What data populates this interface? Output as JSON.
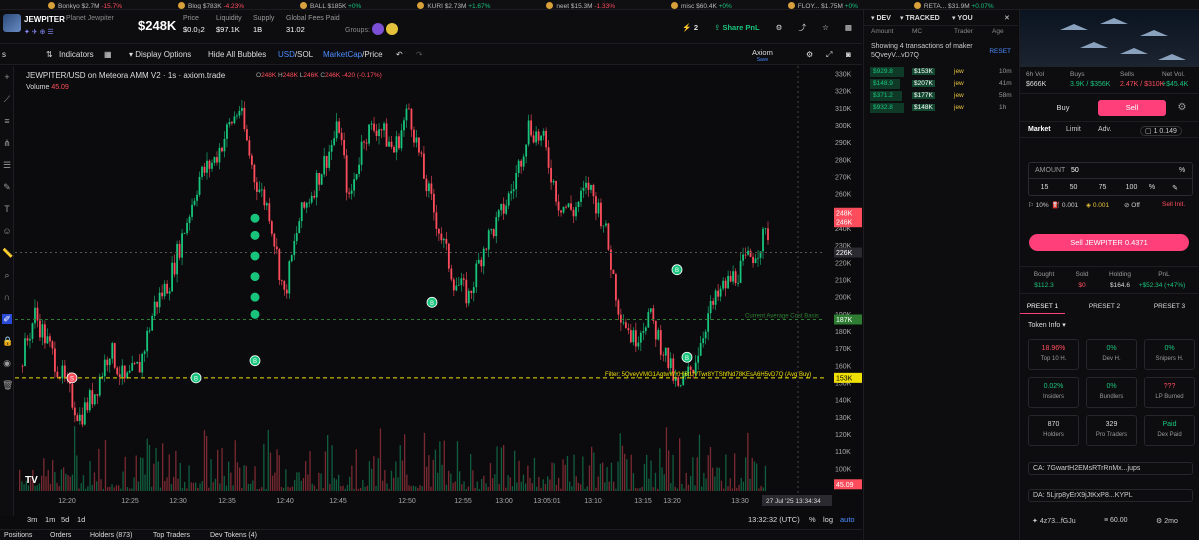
{
  "ticker_strip": [
    {
      "name": "Bonkyo",
      "value": "$2.7M",
      "change": "-15.7%",
      "dir": "dn"
    },
    {
      "name": "Blog",
      "value": "$783K",
      "change": "-4.23%",
      "dir": "dn"
    },
    {
      "name": "BALL",
      "value": "$185K",
      "change": "+0%",
      "dir": "up"
    },
    {
      "name": "KURI",
      "value": "$2.73M",
      "change": "+1.67%",
      "dir": "up"
    },
    {
      "name": "neet",
      "value": "$15.3M",
      "change": "-1.33%",
      "dir": "dn"
    },
    {
      "name": "misc",
      "value": "$60.4K",
      "change": "+0%",
      "dir": "up"
    },
    {
      "name": "FLOY...",
      "value": "$1.75M",
      "change": "+0%",
      "dir": "up"
    },
    {
      "name": "RETA...",
      "value": "$31.9M",
      "change": "+0.07%",
      "dir": "up"
    }
  ],
  "header": {
    "ticker": "JEWPITER",
    "full_name": "Planet Jewpiter",
    "market_cap": "$248K",
    "stats": [
      {
        "label": "Price",
        "value": "$0.0₃2"
      },
      {
        "label": "Liquidity",
        "value": "$97.1K"
      },
      {
        "label": "Supply",
        "value": "1B"
      },
      {
        "label": "Global Fees Paid",
        "value": "31.02"
      }
    ],
    "groups_label": "Groups:",
    "watch_count": "2",
    "share_pnl": "Share PnL"
  },
  "toolbar": {
    "indicators": "Indicators",
    "display_options": "Display Options",
    "hide_bubbles": "Hide All Bubbles",
    "usd": "USD",
    "sol": "SOL",
    "marketcap": "MarketCap",
    "price": "Price",
    "axiom": "Axiom",
    "axiom_sub": "Save"
  },
  "chart_info": {
    "title": "JEWPITER/USD on Meteora AMM V2 · 1s · axiom.trade",
    "ohlc": {
      "o": "248K",
      "h": "248K",
      "l": "246K",
      "c": "246K",
      "chg": "-420 (-0.17%)"
    },
    "volume_label": "Volume",
    "volume_value": "45.09",
    "avg_cost_label": "Current Average Cost Basis",
    "filter_label": "Filter: 5QveyVMG1AgtwWYHj6tUVTwr8YTShfNd78KEsA6H5vD7Q (Avg Buy)",
    "cursor_time": "27 Jul '25",
    "cursor_clock": "13:34:34"
  },
  "chart_data": {
    "type": "candlestick",
    "y_axis": {
      "min": 90,
      "max": 330,
      "unit": "K",
      "ticks": [
        "90K",
        "100K",
        "110K",
        "120K",
        "130K",
        "140K",
        "150K",
        "160K",
        "170K",
        "180K",
        "190K",
        "200K",
        "210K",
        "220K",
        "230K",
        "240K",
        "250K",
        "260K",
        "270K",
        "280K",
        "290K",
        "300K",
        "310K",
        "320K",
        "330K"
      ]
    },
    "x_ticks": [
      "12:20",
      "12:25",
      "12:30",
      "12:35",
      "12:40",
      "12:45",
      "12:50",
      "12:55",
      "13:00",
      "13:05:01",
      "13:10",
      "13:15",
      "13:20",
      "13:30"
    ],
    "price_tags": [
      {
        "label": "248K",
        "color": "#ff4d5d"
      },
      {
        "label": "246K",
        "color": "#ff4d5d"
      },
      {
        "label": "226K",
        "color": "#2a2a30"
      },
      {
        "label": "187K",
        "color": "#2e7d32"
      },
      {
        "label": "153K",
        "color": "#f0e000"
      },
      {
        "label": "45.09",
        "color": "#ff4d5d"
      }
    ],
    "price_path": [
      [
        0,
        160
      ],
      [
        3,
        190
      ],
      [
        6,
        170
      ],
      [
        9,
        150
      ],
      [
        12,
        130
      ],
      [
        15,
        145
      ],
      [
        18,
        170
      ],
      [
        21,
        150
      ],
      [
        24,
        160
      ],
      [
        27,
        195
      ],
      [
        30,
        210
      ],
      [
        33,
        240
      ],
      [
        36,
        270
      ],
      [
        39,
        280
      ],
      [
        42,
        300
      ],
      [
        44,
        310
      ],
      [
        47,
        270
      ],
      [
        50,
        250
      ],
      [
        53,
        200
      ],
      [
        56,
        245
      ],
      [
        59,
        265
      ],
      [
        62,
        285
      ],
      [
        64,
        300
      ],
      [
        66,
        255
      ],
      [
        69,
        295
      ],
      [
        72,
        300
      ],
      [
        75,
        285
      ],
      [
        78,
        310
      ],
      [
        81,
        270
      ],
      [
        84,
        240
      ],
      [
        87,
        210
      ],
      [
        90,
        200
      ],
      [
        93,
        230
      ],
      [
        96,
        245
      ],
      [
        99,
        265
      ],
      [
        102,
        300
      ],
      [
        105,
        290
      ],
      [
        108,
        255
      ],
      [
        111,
        250
      ],
      [
        114,
        265
      ],
      [
        117,
        245
      ],
      [
        120,
        195
      ],
      [
        123,
        175
      ],
      [
        126,
        190
      ],
      [
        129,
        170
      ],
      [
        132,
        145
      ],
      [
        135,
        160
      ],
      [
        138,
        190
      ],
      [
        141,
        205
      ],
      [
        144,
        215
      ],
      [
        147,
        225
      ],
      [
        150,
        238
      ]
    ],
    "series_note": ""
  },
  "bottom": {
    "ranges": [
      "3m",
      "1m",
      "5d",
      "1d"
    ],
    "clock": "13:32:32 (UTC)",
    "pct": "%",
    "log": "log",
    "auto": "auto"
  },
  "bottom_tabs": [
    "Positions",
    "Orders",
    "Holders (873)",
    "Top Traders",
    "Dev Tokens (4)"
  ],
  "trades": {
    "tabs": [
      "DEV",
      "TRACKED",
      "YOU"
    ],
    "cols": [
      "Amount",
      "MC",
      "Trader",
      "Age"
    ],
    "info": "Showing 4 transactions of maker 5QveyV...vD7Q",
    "reset": "RESET",
    "rows": [
      {
        "amount": "$929.8",
        "mc": "$153K",
        "trader": "jew",
        "age": "10m"
      },
      {
        "amount": "$148.9",
        "mc": "$207K",
        "trader": "jew",
        "age": "41m"
      },
      {
        "amount": "$371.2",
        "mc": "$177K",
        "trader": "jew",
        "age": "58m"
      },
      {
        "amount": "$932.8",
        "mc": "$148K",
        "trader": "jew",
        "age": "1h"
      }
    ]
  },
  "panel": {
    "vol": [
      {
        "label": "6h Vol",
        "value": "$666K",
        "cls": "wht"
      },
      {
        "label": "Buys",
        "value": "3.9K / $356K",
        "cls": "grnv"
      },
      {
        "label": "Sells",
        "value": "2.47K / $310K",
        "cls": "redv"
      },
      {
        "label": "Net Vol.",
        "value": "+$45.4K",
        "cls": "grnv"
      }
    ],
    "buy": "Buy",
    "sell": "Sell",
    "order_types": [
      "Market",
      "Limit",
      "Adv."
    ],
    "order_right": "1  0.149",
    "amount_label": "AMOUNT",
    "amount_value": "50",
    "amount_unit": "%",
    "quick": [
      "15",
      "50",
      "75",
      "100",
      "%"
    ],
    "opts": [
      "10%",
      "0.001",
      "0.001",
      "Off",
      "Sell Init."
    ],
    "sell_button": "Sell JEWPITER 0.4371",
    "position": [
      {
        "label": "Bought",
        "value": "$112.3",
        "cls": "grnv"
      },
      {
        "label": "Sold",
        "value": "$0",
        "cls": "redv"
      },
      {
        "label": "Holding",
        "value": "$164.6",
        "cls": "wht"
      },
      {
        "label": "PnL",
        "value": "+$52.34 (+47%)",
        "cls": "grnv"
      }
    ],
    "presets": [
      "PRESET 1",
      "PRESET 2",
      "PRESET 3"
    ],
    "token_info": "Token Info",
    "cards": [
      {
        "value": "18.96%",
        "label": "Top 10 H.",
        "cls": "redv"
      },
      {
        "value": "0%",
        "label": "Dev H.",
        "cls": "grnv"
      },
      {
        "value": "0%",
        "label": "Snipers H.",
        "cls": "grnv"
      },
      {
        "value": "0.02%",
        "label": "Insiders",
        "cls": "grnv"
      },
      {
        "value": "0%",
        "label": "Bundlers",
        "cls": "grnv"
      },
      {
        "value": "???",
        "label": "LP Burned",
        "cls": "redv"
      },
      {
        "value": "870",
        "label": "Holders",
        "cls": "wht"
      },
      {
        "value": "329",
        "label": "Pro Traders",
        "cls": "wht"
      },
      {
        "value": "Paid",
        "label": "Dex Paid",
        "cls": "grnv"
      }
    ],
    "ca": "CA: 7GwartH2EMsRTrRnMx...jups",
    "da": "DA: 5Ljrp8yErX9jJtKxP8...KYPL",
    "da_sub": "4z73...fGJu",
    "da_val": "60.00",
    "da_age": "2mo"
  },
  "colors": {
    "accent": "#ff3f7a",
    "up": "#18c47c",
    "down": "#ff4d5d",
    "avg_line": "#f0e000",
    "cost_line": "#2e7d32"
  }
}
